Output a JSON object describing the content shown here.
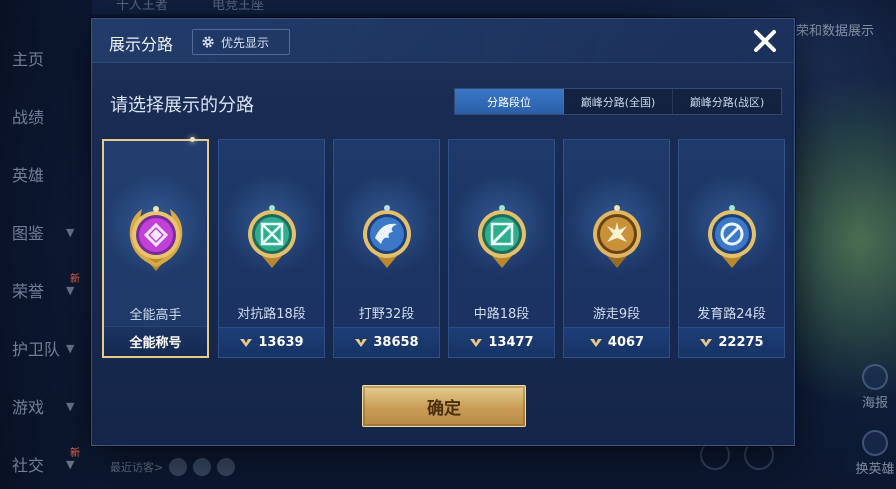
{
  "background": {
    "sidebar": [
      {
        "label": "主页",
        "chevron": false,
        "new": ""
      },
      {
        "label": "战绩",
        "chevron": false,
        "new": ""
      },
      {
        "label": "英雄",
        "chevron": false,
        "new": ""
      },
      {
        "label": "图鉴",
        "chevron": true,
        "new": ""
      },
      {
        "label": "荣誉",
        "chevron": true,
        "new": "新"
      },
      {
        "label": "护卫队",
        "chevron": true,
        "new": ""
      },
      {
        "label": "游戏",
        "chevron": true,
        "new": ""
      },
      {
        "label": "社交",
        "chevron": true,
        "new": "新"
      }
    ],
    "top_texts": [
      "千人王者",
      "电竞王座"
    ],
    "right_top_text": "荣和数据展示",
    "right_buttons": [
      "海报",
      "换英雄"
    ],
    "recent_visitors": "最近访客>"
  },
  "dialog": {
    "title": "展示分路",
    "priority_button": "优先显示",
    "subtitle": "请选择展示的分路",
    "tabs": [
      {
        "label": "分路段位",
        "active": true
      },
      {
        "label": "巅峰分路(全国)",
        "active": false
      },
      {
        "label": "巅峰分路(战区)",
        "active": false
      }
    ],
    "cards": [
      {
        "label": "全能高手",
        "bottom": "全能称号",
        "points": false,
        "selected": true,
        "emblem_color": "#c040d8",
        "emblem_icon": "versatile-icon"
      },
      {
        "label": "对抗路18段",
        "bottom": "13639",
        "points": true,
        "selected": false,
        "emblem_color": "#2fae8e",
        "emblem_icon": "clash-lane-icon"
      },
      {
        "label": "打野32段",
        "bottom": "38658",
        "points": true,
        "selected": false,
        "emblem_color": "#3b78c8",
        "emblem_icon": "jungle-icon"
      },
      {
        "label": "中路18段",
        "bottom": "13477",
        "points": true,
        "selected": false,
        "emblem_color": "#2fae8e",
        "emblem_icon": "mid-lane-icon"
      },
      {
        "label": "游走9段",
        "bottom": "4067",
        "points": true,
        "selected": false,
        "emblem_color": "#c8913a",
        "emblem_icon": "roam-icon"
      },
      {
        "label": "发育路24段",
        "bottom": "22275",
        "points": true,
        "selected": false,
        "emblem_color": "#3b78c8",
        "emblem_icon": "farm-lane-icon"
      }
    ],
    "confirm_button": "确定"
  }
}
